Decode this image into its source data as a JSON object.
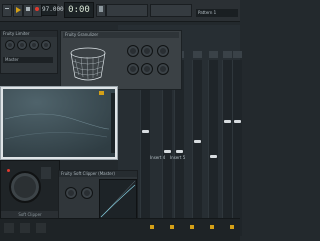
{
  "toolbar": {
    "tempo": "97.000",
    "time": "0:00",
    "time_sub": "00",
    "pattern": "Pattern 1"
  },
  "plugin_wave": {
    "title": "Fruity Granulizer"
  },
  "plugin_small": {
    "title": "Fruity Limiter",
    "preset": "Master"
  },
  "clipper": {
    "footer": "Soft Clipper"
  },
  "soft_clip": {
    "title": "Fruity Soft Clipper (Master)"
  },
  "mixer": {
    "insert_labels": [
      "Insert 1",
      "Insert 2",
      "Insert 3",
      "Insert 4",
      "Insert 5",
      "Insert 6",
      "Insert 7",
      "Insert 8"
    ],
    "bottom_labels": [
      "Insert 4",
      "Insert 5"
    ]
  },
  "colors": {
    "accent": "#d4a017",
    "eq_bg": "#38484f",
    "record": "#e03a2f"
  },
  "icons": [
    "play-icon",
    "stop-icon",
    "record-icon",
    "metronome-icon",
    "menu-icon"
  ]
}
